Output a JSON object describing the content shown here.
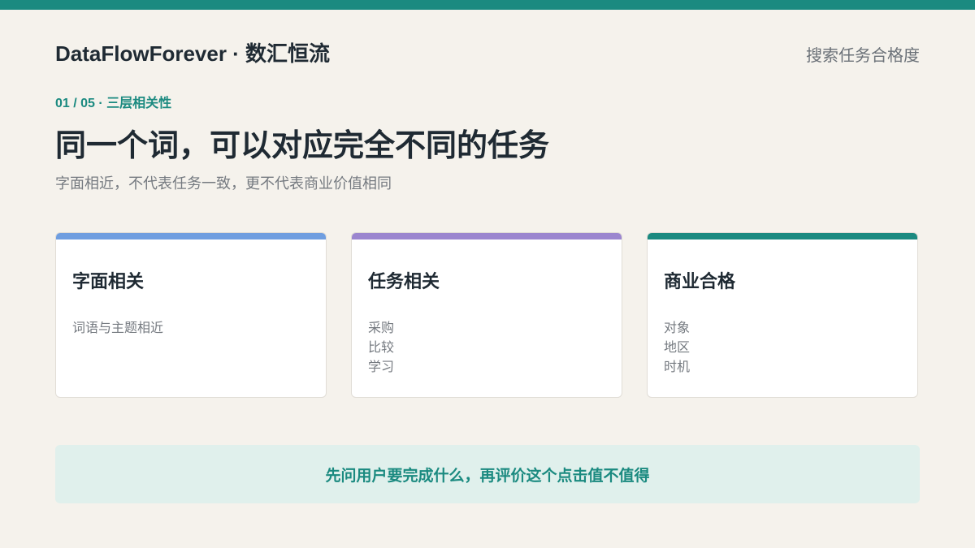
{
  "brand": {
    "title": "DataFlowForever · 数汇恒流"
  },
  "header": {
    "topic": "搜索任务合格度"
  },
  "slide": {
    "kicker": "01 / 05 · 三层相关性",
    "headline": "同一个词，可以对应完全不同的任务",
    "subtitle": "字面相近，不代表任务一致，更不代表商业价值相同"
  },
  "cards": [
    {
      "title": "字面相关",
      "items": [
        "词语与主题相近"
      ],
      "accent_color": "#6f9ee0"
    },
    {
      "title": "任务相关",
      "items": [
        "采购",
        "比较",
        "学习"
      ],
      "accent_color": "#9b86cf"
    },
    {
      "title": "商业合格",
      "items": [
        "对象",
        "地区",
        "时机"
      ],
      "accent_color": "#1b8a80"
    }
  ],
  "callout": {
    "text": "先问用户要完成什么，再评价这个点击值不值得"
  },
  "colors": {
    "brand_teal": "#1b8a80",
    "background": "#f5f2ec",
    "callout_bg": "#e0f0ec"
  }
}
